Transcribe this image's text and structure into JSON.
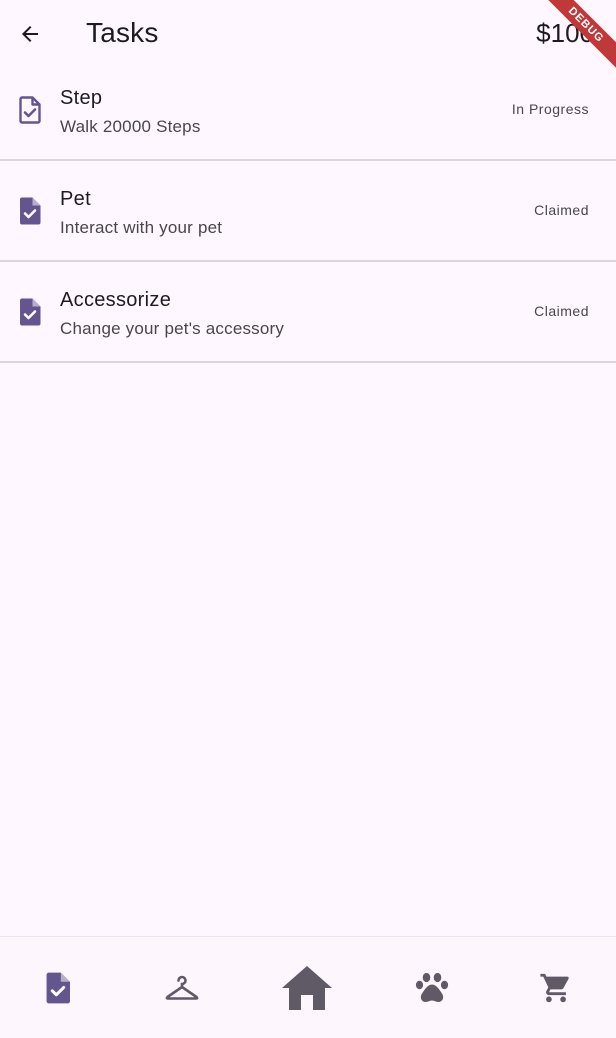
{
  "app_bar": {
    "title": "Tasks",
    "balance": "$100",
    "back_icon": "arrow-back-icon"
  },
  "debug_banner": {
    "label": "DEBUG",
    "color": "#c0393a"
  },
  "tasks": [
    {
      "title": "Step",
      "description": "Walk 20000 Steps",
      "status": "In Progress",
      "icon": "task-check-outline-icon"
    },
    {
      "title": "Pet",
      "description": "Interact with your pet",
      "status": "Claimed",
      "icon": "task-check-filled-icon"
    },
    {
      "title": "Accessorize",
      "description": "Change your pet's accessory",
      "status": "Claimed",
      "icon": "task-check-filled-icon"
    }
  ],
  "bottom_nav": {
    "items": [
      {
        "icon": "task-icon",
        "active": true
      },
      {
        "icon": "hanger-icon",
        "active": false
      },
      {
        "icon": "home-icon",
        "active": false
      },
      {
        "icon": "paw-icon",
        "active": false
      },
      {
        "icon": "cart-icon",
        "active": false
      }
    ]
  },
  "colors": {
    "accent": "#65558f",
    "background": "#fef7ff",
    "divider": "#d8d5dc",
    "inactive_icon": "#5f5a66"
  }
}
